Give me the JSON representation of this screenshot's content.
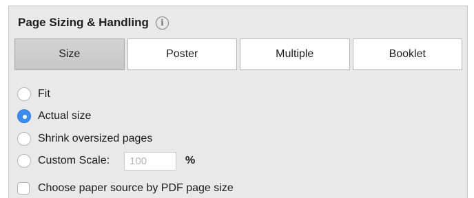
{
  "section": {
    "title": "Page Sizing & Handling",
    "info_icon_glyph": "i"
  },
  "tabs": [
    {
      "label": "Size",
      "active": true
    },
    {
      "label": "Poster",
      "active": false
    },
    {
      "label": "Multiple",
      "active": false
    },
    {
      "label": "Booklet",
      "active": false
    }
  ],
  "options": {
    "fit": {
      "label": "Fit",
      "checked": false
    },
    "actual_size": {
      "label": "Actual size",
      "checked": true
    },
    "shrink": {
      "label": "Shrink oversized pages",
      "checked": false
    },
    "custom_scale": {
      "label": "Custom Scale:",
      "checked": false,
      "value": "",
      "placeholder": "100",
      "unit": "%"
    }
  },
  "paper_source": {
    "label": "Choose paper source by PDF page size",
    "checked": false
  },
  "colors": {
    "accent": "#3b8cf0",
    "panel_bg": "#e9e9e9",
    "active_tab_bg": "#cccccc"
  }
}
